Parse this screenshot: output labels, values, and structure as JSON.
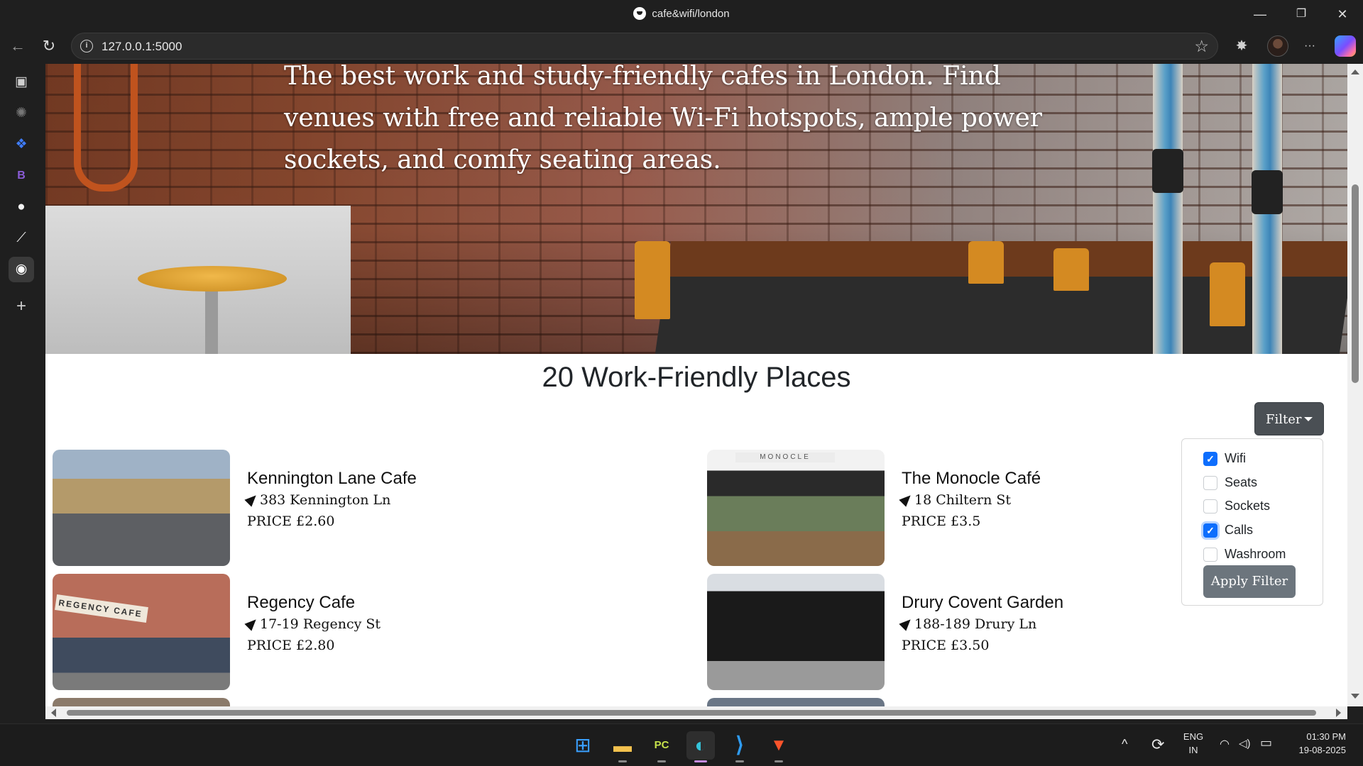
{
  "window": {
    "title": "cafe&wifi/london",
    "minimize_glyph": "—",
    "maximize_glyph": "❐",
    "close_glyph": "✕"
  },
  "browser": {
    "url": "127.0.0.1:5000",
    "back_glyph": "←",
    "reload_glyph": "↻",
    "star_glyph": "☆",
    "extensions_glyph": "✸",
    "menu_glyph": "···",
    "sidebar_glyphs": {
      "tabs": "▣",
      "chatgpt": "✺",
      "dropbox": "❖",
      "bootstrap": "B",
      "github": "●",
      "vscode": "⟋",
      "cafe": "◉",
      "add": "+"
    }
  },
  "page": {
    "hero_text": "The best work and study-friendly cafes in London. Find venues with free and reliable Wi-Fi hotspots, ample power sockets, and comfy seating areas.",
    "heading": "20 Work-Friendly Places",
    "filter": {
      "button_label": "Filter",
      "apply_label": "Apply Filter",
      "options": [
        {
          "label": "Wifi",
          "checked": true
        },
        {
          "label": "Seats",
          "checked": false
        },
        {
          "label": "Sockets",
          "checked": false
        },
        {
          "label": "Calls",
          "checked": true
        },
        {
          "label": "Washroom",
          "checked": false
        }
      ],
      "check_glyph": "✓"
    },
    "cafes": [
      {
        "name": "Kennington Lane Cafe",
        "address": "383 Kennington Ln",
        "price": "PRICE £2.60"
      },
      {
        "name": "The Monocle Café",
        "address": "18 Chiltern St",
        "price": "PRICE £3.5",
        "image_sign": "MONOCLE"
      },
      {
        "name": "Regency Cafe",
        "address": "17-19 Regency St",
        "price": "PRICE £2.80",
        "image_sign": "REGENCY CAFE"
      },
      {
        "name": "Drury Covent Garden",
        "address": "188-189 Drury Ln",
        "price": "PRICE £3.50"
      }
    ]
  },
  "taskbar": {
    "apps": [
      {
        "name": "start",
        "glyph": "⊞",
        "color": "#3aa0ff"
      },
      {
        "name": "file-explorer",
        "glyph": "▬",
        "color": "#f2c14e"
      },
      {
        "name": "pycharm",
        "glyph": "PC",
        "color": "#c6e14b"
      },
      {
        "name": "edge",
        "glyph": "◐",
        "color": "#35c3d9"
      },
      {
        "name": "vscode",
        "glyph": "⟩",
        "color": "#2f9bf0"
      },
      {
        "name": "brave",
        "glyph": "▼",
        "color": "#fb542b"
      }
    ],
    "tray": {
      "chevron": "^",
      "sync_glyph": "⟳",
      "lang_line1": "ENG",
      "lang_line2": "IN",
      "wifi_glyph": "◠",
      "volume_glyph": "◁)",
      "battery_glyph": "▭",
      "time": "01:30 PM",
      "date": "19-08-2025"
    }
  }
}
